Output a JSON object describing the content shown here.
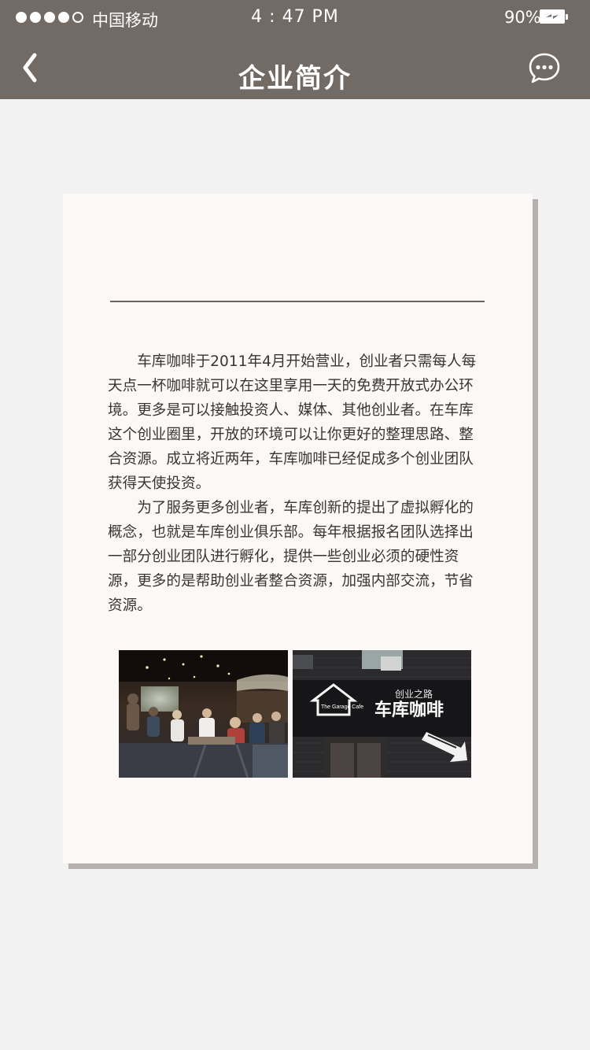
{
  "status_bar": {
    "carrier": "中国移动",
    "time": "4 : 47 PM",
    "battery_percent": "90%",
    "signal_bars": 4,
    "signal_max": 5,
    "battery_level": 0.9,
    "battery_state": "charging"
  },
  "nav": {
    "back_icon": "chevron-left-icon",
    "title": "企业简介",
    "chat_icon": "chat-bubble-icon"
  },
  "content": {
    "paragraphs": [
      "车库咖啡于2011年4月开始营业，创业者只需每人每天点一杯咖啡就可以在这里享用一天的免费开放式办公环境。更多是可以接触投资人、媒体、其他创业者。在车库这个创业圈里，开放的环境可以让你更好的整理思路、整合资源。成立将近两年，车库咖啡已经促成多个创业团队获得天使投资。",
      "为了服务更多创业者，车库创新的提出了虚拟孵化的概念，也就是车库创业俱乐部。每年根据报名团队选择出一部分创业团队进行孵化，提供一些创业必须的硬性资源，更多的是帮助创业者整合资源，加强内部交流，节省资源。"
    ],
    "photo_sign": {
      "slogan": "创业之路",
      "name": "车库咖啡",
      "logo_small": "The Garage Cafe"
    }
  },
  "colors": {
    "header_bg": "#726a65",
    "page_bg": "#f3f2f2",
    "card_bg": "#fcf8f7",
    "text": "#3a3535"
  }
}
